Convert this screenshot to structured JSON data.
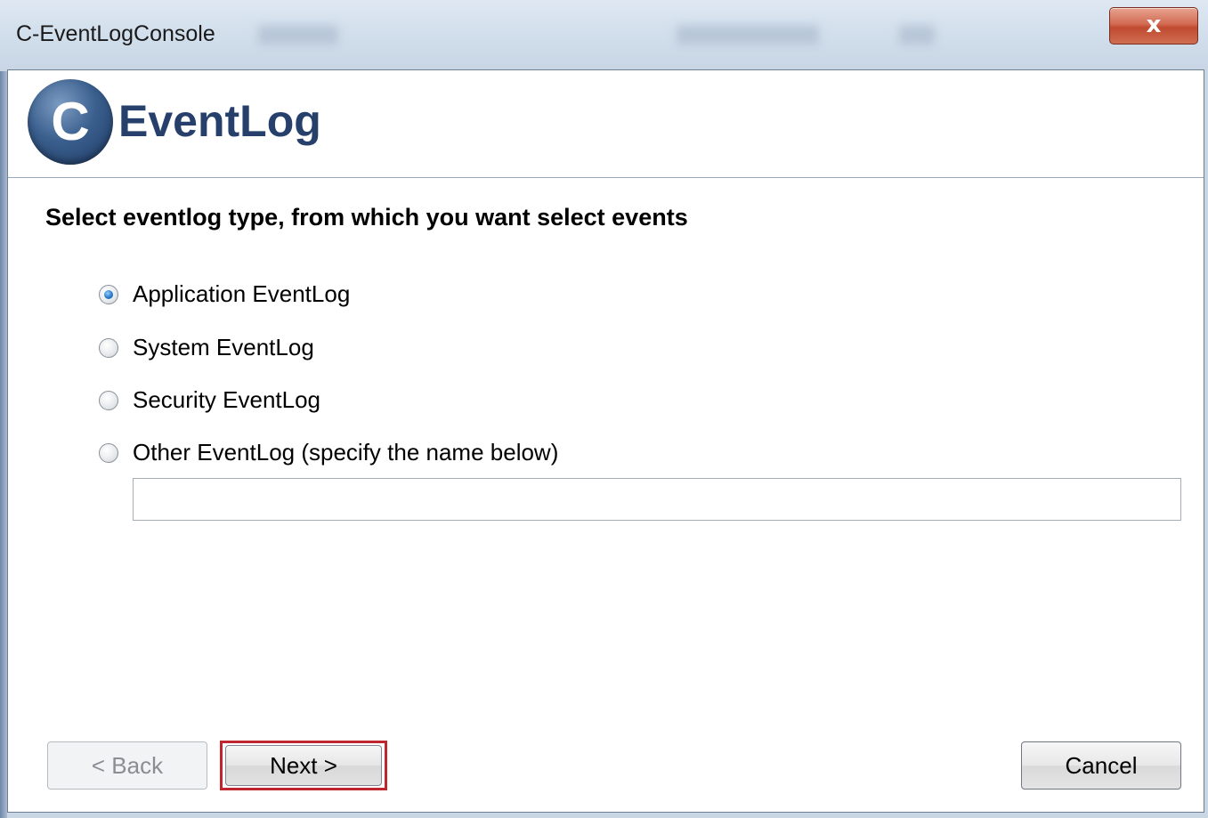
{
  "window": {
    "title": "C-EventLogConsole",
    "close_label": "x"
  },
  "banner": {
    "logo_letter": "C",
    "logo_text": "EventLog"
  },
  "wizard": {
    "heading": "Select eventlog type, from which you want select events",
    "options": [
      {
        "label": "Application EventLog",
        "checked": true
      },
      {
        "label": "System EventLog",
        "checked": false
      },
      {
        "label": "Security EventLog",
        "checked": false
      },
      {
        "label": "Other EventLog (specify the name below)",
        "checked": false
      }
    ],
    "other_name_value": ""
  },
  "buttons": {
    "back_label": "< Back",
    "back_enabled": false,
    "next_label": "Next >",
    "cancel_label": "Cancel"
  },
  "colors": {
    "highlight": "#c0262d",
    "brand": "#27406b"
  }
}
